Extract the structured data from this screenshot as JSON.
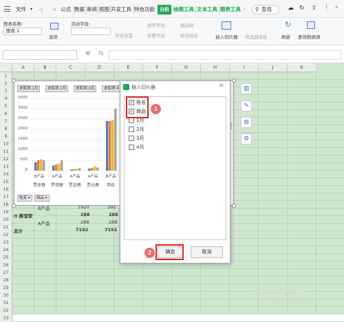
{
  "menubar": {
    "file": "文件",
    "more": "»",
    "tabs": [
      "公式",
      "数据",
      "审阅",
      "视图",
      "开发工具",
      "特色功能"
    ],
    "analysis_tab": "分析",
    "chart_tabs": [
      "绘图工具",
      "文本工具",
      "图表工具"
    ],
    "search": "查找"
  },
  "toolbar": {
    "chart_name_label": "图表名称:",
    "chart_name_value": "图表 1",
    "options_label": "选项",
    "active_field_label": "活动字段:",
    "field_settings": "字段设置",
    "expand_field": "展开字段",
    "collapse_field": "折叠字段",
    "group_select": "组选择",
    "ungroup": "取消组合",
    "insert_slicer": "插入切片器",
    "filter_connection": "筛选器连接",
    "refresh": "刷新",
    "change_source": "更改数据源"
  },
  "formula": {
    "fx": "fx"
  },
  "columns": [
    "A",
    "B",
    "C",
    "D",
    "E",
    "F",
    "G",
    "H",
    "I",
    "J",
    "K"
  ],
  "rows": [
    "1",
    "2",
    "3",
    "4",
    "5",
    "6",
    "7",
    "8",
    "9",
    "10",
    "11",
    "12",
    "13",
    "14",
    "15",
    "16",
    "17",
    "18",
    "19",
    "20",
    "21",
    "22",
    "23",
    "24",
    "25",
    "26",
    "27",
    "28",
    "29",
    "30",
    "31",
    "32",
    "33"
  ],
  "chart": {
    "field_buttons": [
      "求和项:1月",
      "求和项:2月",
      "求和项:3月",
      "求和项:4"
    ],
    "y_ticks": [
      "3500",
      "3000",
      "2500",
      "2000",
      "1500",
      "1000",
      "500",
      "0"
    ],
    "categories": [
      "B产品",
      "A产品",
      "A产品",
      "A产品",
      "B产品"
    ],
    "names": [
      "贾探春",
      "贾惜春",
      "贾迎春",
      "贾元春",
      "李纨"
    ],
    "filter_buttons": [
      "姓名",
      "商品"
    ]
  },
  "chart_data": {
    "type": "bar",
    "categories": [
      "B产品\n贾探春",
      "A产品\n贾惜春",
      "A产品\n贾迎春",
      "A产品\n贾元春",
      "B产品\n李纨"
    ],
    "ylim": [
      0,
      3500
    ],
    "series": [
      {
        "name": "求和项:1月",
        "values": [
          400,
          250,
          50,
          100,
          2400
        ]
      },
      {
        "name": "求和项:2月",
        "values": [
          500,
          300,
          70,
          130,
          2400
        ]
      },
      {
        "name": "求和项:3月",
        "values": [
          550,
          350,
          90,
          200,
          2450
        ]
      },
      {
        "name": "求和项:4",
        "values": [
          500,
          500,
          120,
          150,
          3000
        ]
      }
    ],
    "colors": [
      "#4a7cc7",
      "#ed7d31",
      "#f2b82a",
      "#a5a5a5"
    ]
  },
  "table": {
    "r19": {
      "b": "B产品",
      "c": "1920",
      "d": "192"
    },
    "r20": {
      "a": "⊟ 薛宝钗",
      "c": "288",
      "d": "288"
    },
    "r21": {
      "b": "A产品",
      "c": "288",
      "d": "288"
    },
    "r22": {
      "a": "总计",
      "c": "7152",
      "d": "7152"
    }
  },
  "dialog": {
    "title": "插入切片器",
    "items": [
      {
        "label": "姓名",
        "checked": true,
        "mark": "✓"
      },
      {
        "label": "商品",
        "checked": true,
        "mark": "✓"
      },
      {
        "label": "1月",
        "checked": false,
        "mark": ""
      },
      {
        "label": "2月",
        "checked": false,
        "mark": ""
      },
      {
        "label": "3月",
        "checked": false,
        "mark": ""
      },
      {
        "label": "4月",
        "checked": false,
        "mark": ""
      }
    ],
    "ok": "确定",
    "cancel": "取消",
    "badge1": "1",
    "badge2": "2"
  },
  "watermark": "Baidu经验",
  "watermark_url": "jingyan.baidu.com"
}
